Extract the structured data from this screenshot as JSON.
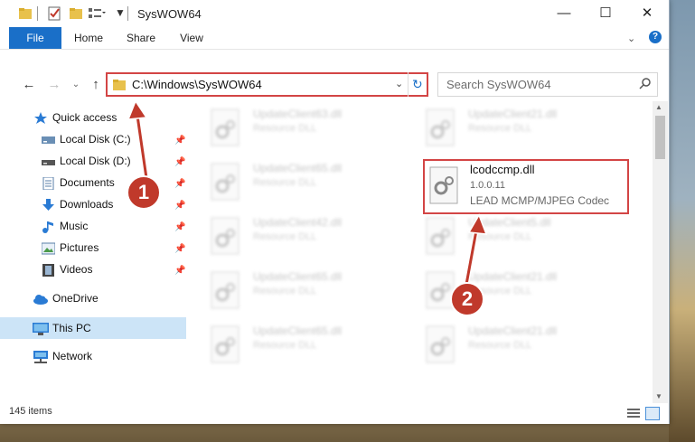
{
  "window": {
    "title": "SysWOW64"
  },
  "ribbon": {
    "tabs": [
      "File",
      "Home",
      "Share",
      "View"
    ]
  },
  "address": {
    "path": "C:\\Windows\\SysWOW64"
  },
  "search": {
    "placeholder": "Search SysWOW64"
  },
  "sidebar": {
    "items": [
      {
        "label": "Quick access",
        "icon": "star-icon"
      },
      {
        "label": "Local Disk (C:)",
        "icon": "drive-icon",
        "pinned": true
      },
      {
        "label": "Local Disk (D:)",
        "icon": "drive-icon",
        "pinned": true
      },
      {
        "label": "Documents",
        "icon": "documents-icon",
        "pinned": true
      },
      {
        "label": "Downloads",
        "icon": "download-icon",
        "pinned": true
      },
      {
        "label": "Music",
        "icon": "music-icon",
        "pinned": true
      },
      {
        "label": "Pictures",
        "icon": "pictures-icon",
        "pinned": true
      },
      {
        "label": "Videos",
        "icon": "videos-icon",
        "pinned": true
      },
      {
        "label": "OneDrive",
        "icon": "cloud-icon"
      },
      {
        "label": "This PC",
        "icon": "computer-icon",
        "selected": true
      },
      {
        "label": "Network",
        "icon": "network-icon"
      }
    ]
  },
  "files": {
    "left_column": [
      {
        "name": "UpdateClient63.dll",
        "type": "Resource DLL"
      },
      {
        "name": "UpdateClient65.dll",
        "type": "Resource DLL"
      },
      {
        "name": "UpdateClient42.dll",
        "type": "Resource DLL"
      },
      {
        "name": "UpdateClient65.dll",
        "type": "Resource DLL"
      },
      {
        "name": "UpdateClient65.dll",
        "type": "Resource DLL"
      }
    ],
    "right_column": [
      {
        "name": "UpdateClient21.dll",
        "type": "Resource DLL"
      },
      {
        "name": "UpdateClient5.dll",
        "type": "Resource DLL"
      },
      {
        "name": "UpdateClient21.dll",
        "type": "Resource DLL"
      },
      {
        "name": "UpdateClient21.dll",
        "type": "Resource DLL"
      }
    ],
    "highlighted": {
      "name": "lcodccmp.dll",
      "version": "1.0.0.11",
      "description": "LEAD MCMP/MJPEG Codec"
    }
  },
  "status": {
    "count": "145 items"
  },
  "annotations": {
    "step1": "1",
    "step2": "2",
    "color": "#c0392b"
  },
  "colors": {
    "accent": "#1a6fc8",
    "highlight": "#d34545",
    "selection": "#cce4f7"
  }
}
